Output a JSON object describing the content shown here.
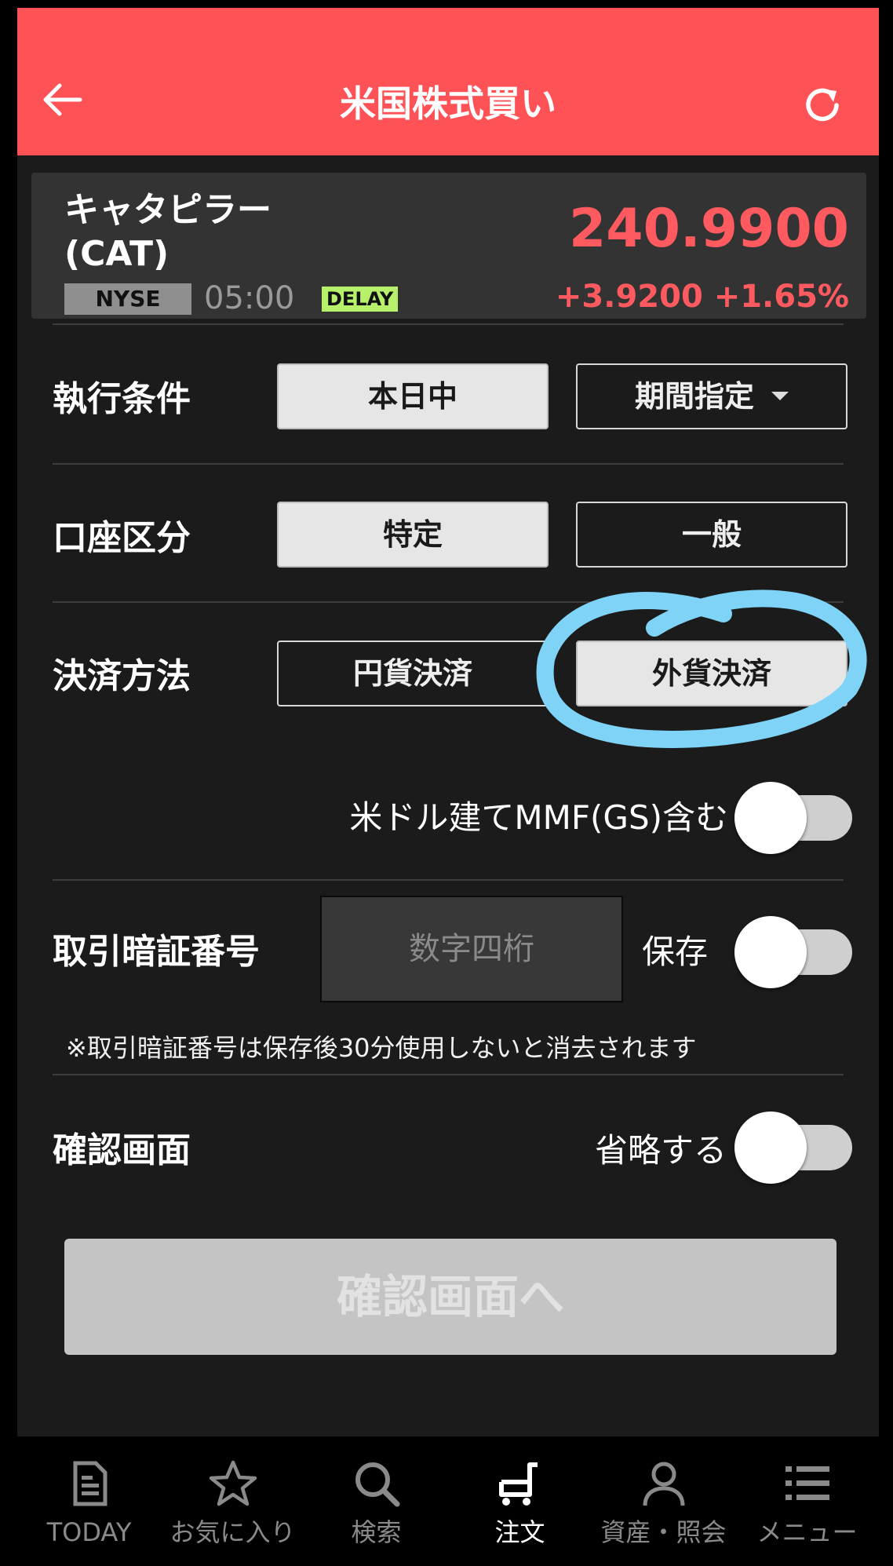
{
  "header": {
    "title": "米国株式買い"
  },
  "stock": {
    "name": "キャタピラー",
    "ticker": "(CAT)",
    "market": "NYSE",
    "time": "05:00",
    "delay_label": "DELAY",
    "price": "240.9900",
    "change": "+3.9200 +1.65%"
  },
  "execution": {
    "label": "執行条件",
    "options": [
      "本日中",
      "期間指定"
    ],
    "selected": "本日中"
  },
  "account": {
    "label": "口座区分",
    "options": [
      "特定",
      "一般"
    ],
    "selected": "特定"
  },
  "settlement": {
    "label": "決済方法",
    "options": [
      "円貨決済",
      "外貨決済"
    ],
    "selected": "外貨決済"
  },
  "mmf": {
    "label": "米ドル建てMMF(GS)含む",
    "enabled": false
  },
  "pin": {
    "label": "取引暗証番号",
    "placeholder": "数字四桁",
    "save_label": "保存",
    "save_enabled": false,
    "note": "※取引暗証番号は保存後30分使用しないと消去されます"
  },
  "confirm_screen": {
    "label": "確認画面",
    "skip_label": "省略する",
    "skip_enabled": false
  },
  "confirm_button": {
    "label": "確認画面へ"
  },
  "colors": {
    "header_bg": "#ff5257",
    "price": "#ff5a5f",
    "annotation": "#7fd3f7",
    "delay_badge": "#b7f06b"
  },
  "bottom_nav": [
    {
      "label": "TODAY",
      "icon": "document-icon",
      "active": false
    },
    {
      "label": "お気に入り",
      "icon": "star-icon",
      "active": false
    },
    {
      "label": "検索",
      "icon": "search-icon",
      "active": false
    },
    {
      "label": "注文",
      "icon": "cart-icon",
      "active": true
    },
    {
      "label": "資産・照会",
      "icon": "person-icon",
      "active": false
    },
    {
      "label": "メニュー",
      "icon": "menu-list-icon",
      "active": false
    }
  ]
}
